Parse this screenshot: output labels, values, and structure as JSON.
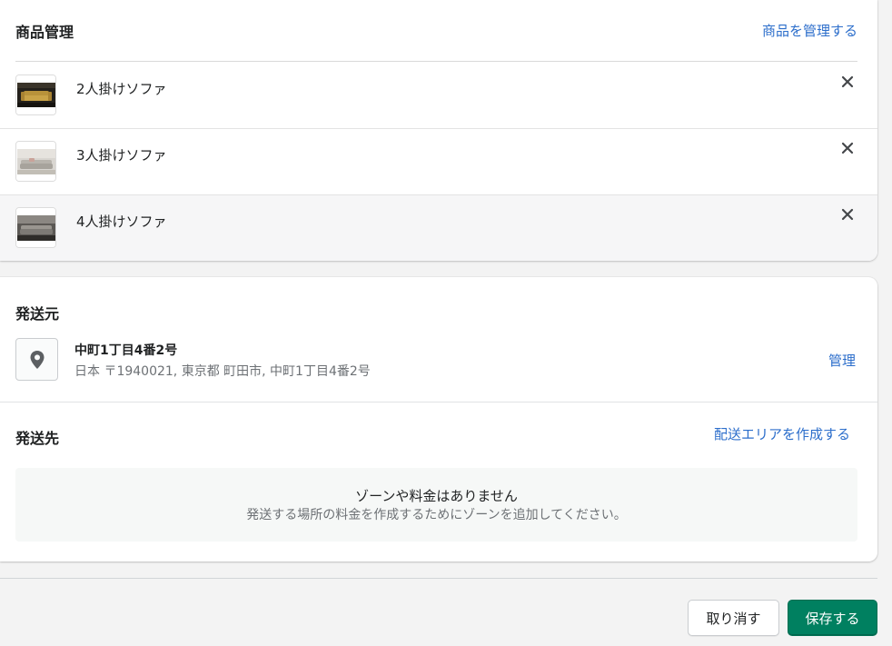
{
  "products_section": {
    "title": "商品管理",
    "manage_link": "商品を管理する",
    "items": [
      {
        "name": "2人掛けソファ",
        "thumbnail": "yellow-sofa-dark-room"
      },
      {
        "name": "3人掛けソファ",
        "thumbnail": "grey-sofa-light-room"
      },
      {
        "name": "4人掛けソファ",
        "thumbnail": "grey-sofa-dark-room"
      }
    ],
    "remove_icon": "close-icon"
  },
  "origin_section": {
    "title": "発送元",
    "location_name": "中町1丁目4番2号",
    "location_address": "日本 〒1940021, 東京都 町田市, 中町1丁目4番2号",
    "manage_link": "管理",
    "icon": "location-pin-icon"
  },
  "destination_section": {
    "title": "発送先",
    "create_zone_link": "配送エリアを作成する",
    "empty_title": "ゾーンや料金はありません",
    "empty_subtitle": "発送する場所の料金を作成するためにゾーンを追加してください。"
  },
  "footer": {
    "cancel_label": "取り消す",
    "save_label": "保存する"
  },
  "colors": {
    "link": "#2c6ecb",
    "primary": "#008060",
    "background": "#f3f3f3"
  }
}
